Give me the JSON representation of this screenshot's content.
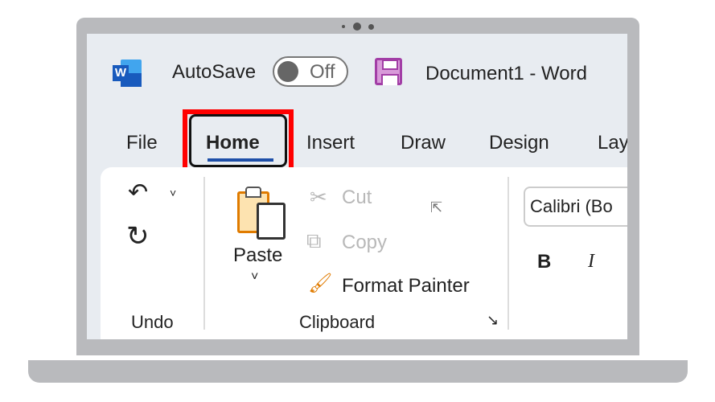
{
  "titlebar": {
    "autosave_label": "AutoSave",
    "autosave_state": "Off",
    "document_title": "Document1  -  Word"
  },
  "tabs": [
    {
      "label": "File"
    },
    {
      "label": "Home",
      "selected": true,
      "highlighted": true
    },
    {
      "label": "Insert"
    },
    {
      "label": "Draw"
    },
    {
      "label": "Design"
    },
    {
      "label": "Lay"
    }
  ],
  "ribbon": {
    "undo_group": {
      "label": "Undo"
    },
    "clipboard_group": {
      "label": "Clipboard",
      "paste": "Paste",
      "cut": "Cut",
      "copy": "Copy",
      "format_painter": "Format Painter"
    },
    "font_group": {
      "font_name": "Calibri (Bo",
      "bold": "B",
      "italic": "I"
    }
  },
  "colors": {
    "highlight": "#ff0000",
    "tab_underline": "#1e4fa8",
    "word_blue": "#185abd",
    "save_purple": "#a23ea6",
    "accent_orange": "#e07b00"
  }
}
